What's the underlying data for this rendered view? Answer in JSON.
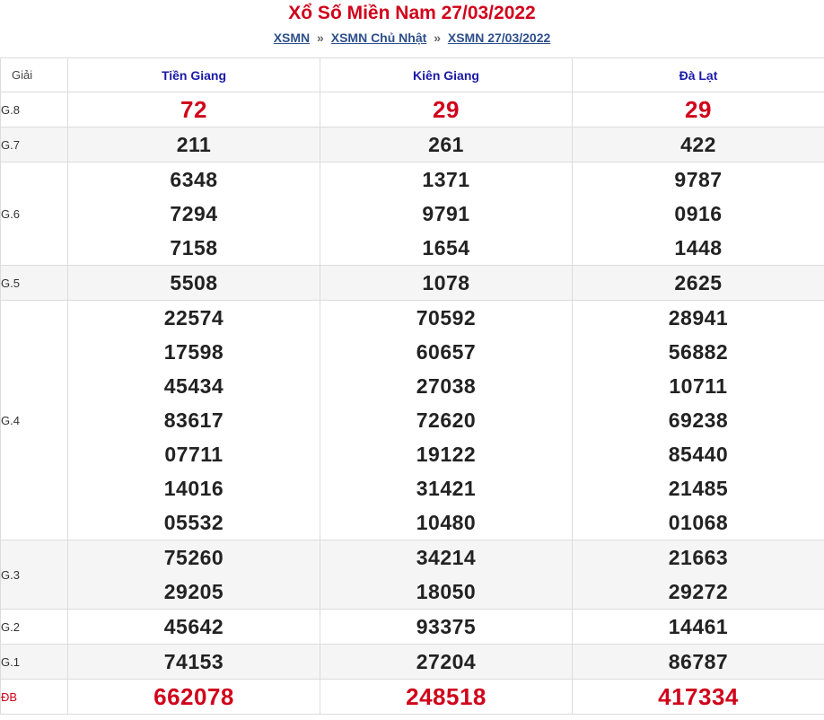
{
  "header": {
    "title": "Xổ Số Miền Nam 27/03/2022",
    "breadcrumb": [
      {
        "label": "XSMN"
      },
      {
        "label": "XSMN Chủ Nhật"
      },
      {
        "label": "XSMN 27/03/2022"
      }
    ],
    "separator": "»"
  },
  "table": {
    "prize_header": "Giải",
    "provinces": [
      "Tiền Giang",
      "Kiên Giang",
      "Đà Lạt"
    ],
    "rows": [
      {
        "label": "G.8",
        "highlight": true,
        "values": [
          [
            "72"
          ],
          [
            "29"
          ],
          [
            "29"
          ]
        ]
      },
      {
        "label": "G.7",
        "values": [
          [
            "211"
          ],
          [
            "261"
          ],
          [
            "422"
          ]
        ]
      },
      {
        "label": "G.6",
        "values": [
          [
            "6348",
            "7294",
            "7158"
          ],
          [
            "1371",
            "9791",
            "1654"
          ],
          [
            "9787",
            "0916",
            "1448"
          ]
        ]
      },
      {
        "label": "G.5",
        "values": [
          [
            "5508"
          ],
          [
            "1078"
          ],
          [
            "2625"
          ]
        ]
      },
      {
        "label": "G.4",
        "values": [
          [
            "22574",
            "17598",
            "45434",
            "83617",
            "07711",
            "14016",
            "05532"
          ],
          [
            "70592",
            "60657",
            "27038",
            "72620",
            "19122",
            "31421",
            "10480"
          ],
          [
            "28941",
            "56882",
            "10711",
            "69238",
            "85440",
            "21485",
            "01068"
          ]
        ]
      },
      {
        "label": "G.3",
        "values": [
          [
            "75260",
            "29205"
          ],
          [
            "34214",
            "18050"
          ],
          [
            "21663",
            "29272"
          ]
        ]
      },
      {
        "label": "G.2",
        "values": [
          [
            "45642"
          ],
          [
            "93375"
          ],
          [
            "14461"
          ]
        ]
      },
      {
        "label": "G.1",
        "values": [
          [
            "74153"
          ],
          [
            "27204"
          ],
          [
            "86787"
          ]
        ]
      },
      {
        "label": "ĐB",
        "highlight": true,
        "special": true,
        "values": [
          [
            "662078"
          ],
          [
            "248518"
          ],
          [
            "417334"
          ]
        ]
      }
    ]
  },
  "colors": {
    "title": "#d0021b",
    "province_header": "#1a1aa6",
    "link": "#2d4f8a",
    "alt_row": "#f5f5f5"
  }
}
